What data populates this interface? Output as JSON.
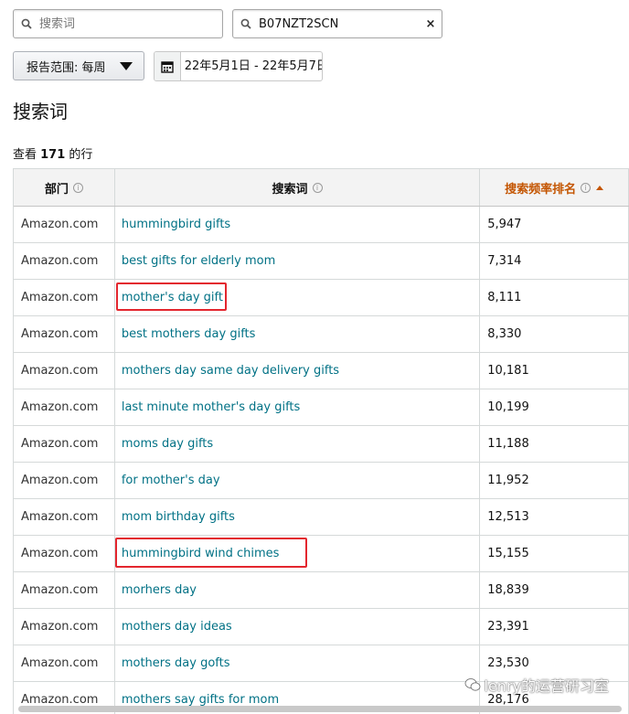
{
  "search": {
    "keyword_placeholder": "搜索词",
    "keyword_value": "",
    "asin_value": "B07NZT2SCN",
    "clear_symbol": "×"
  },
  "report_range": {
    "label": "报告范围: 每周"
  },
  "date_range": {
    "value": "22年5月1日 - 22年5月7日"
  },
  "page_title": "搜索词",
  "row_count": {
    "prefix": "查看 ",
    "count": "171",
    "suffix": " 的行"
  },
  "table": {
    "headers": {
      "department": "部门",
      "search_term": "搜索词",
      "rank": "搜索频率排名"
    },
    "rows": [
      {
        "department": "Amazon.com",
        "term": "hummingbird gifts",
        "rank": "5,947"
      },
      {
        "department": "Amazon.com",
        "term": "best gifts for elderly mom",
        "rank": "7,314"
      },
      {
        "department": "Amazon.com",
        "term": "mother's day gift",
        "rank": "8,111"
      },
      {
        "department": "Amazon.com",
        "term": "best mothers day gifts",
        "rank": "8,330"
      },
      {
        "department": "Amazon.com",
        "term": "mothers day same day delivery gifts",
        "rank": "10,181"
      },
      {
        "department": "Amazon.com",
        "term": "last minute mother's day gifts",
        "rank": "10,199"
      },
      {
        "department": "Amazon.com",
        "term": "moms day gifts",
        "rank": "11,188"
      },
      {
        "department": "Amazon.com",
        "term": "for mother's day",
        "rank": "11,952"
      },
      {
        "department": "Amazon.com",
        "term": "mom birthday gifts",
        "rank": "12,513"
      },
      {
        "department": "Amazon.com",
        "term": "hummingbird wind chimes",
        "rank": "15,155"
      },
      {
        "department": "Amazon.com",
        "term": "morhers day",
        "rank": "18,839"
      },
      {
        "department": "Amazon.com",
        "term": "mothers day ideas",
        "rank": "23,391"
      },
      {
        "department": "Amazon.com",
        "term": "mothers day gofts",
        "rank": "23,530"
      },
      {
        "department": "Amazon.com",
        "term": "mothers say gifts for mom",
        "rank": "28,176"
      }
    ]
  },
  "watermark": "lenry的运营研习室",
  "colors": {
    "link": "#007185",
    "sorted_header": "#c45500",
    "highlight": "#e3262e"
  }
}
